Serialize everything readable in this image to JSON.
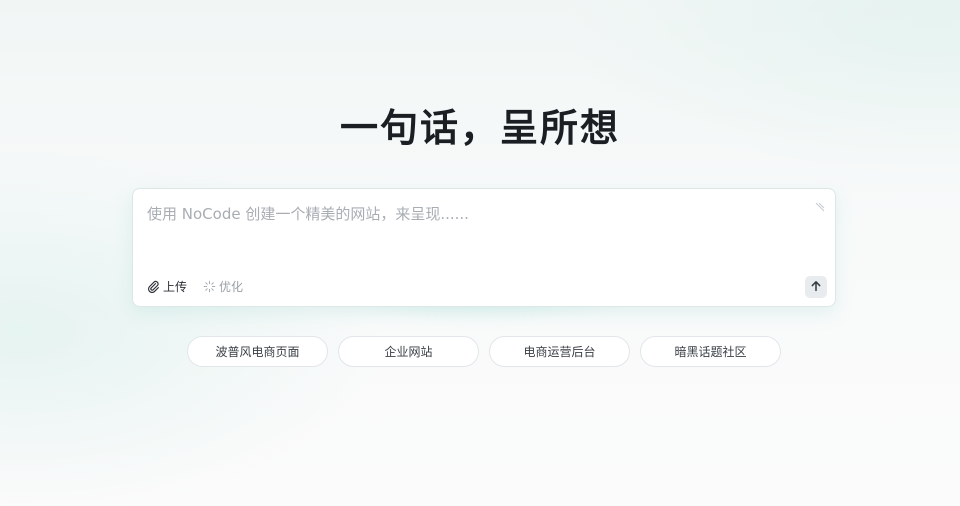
{
  "hero": {
    "title": "一句话，呈所想"
  },
  "prompt": {
    "placeholder": "使用 NoCode 创建一个精美的网站，来呈现......",
    "value": ""
  },
  "toolbar": {
    "upload_label": "上传",
    "optimize_label": "优化"
  },
  "suggestions": [
    "波普风电商页面",
    "企业网站",
    "电商运营后台",
    "暗黑话题社区"
  ],
  "icons": {
    "upload": "paperclip-icon",
    "optimize": "sparkle-icon",
    "send": "arrow-up-icon",
    "resize": "resize-handle-icon"
  },
  "colors": {
    "title": "#1b1f24",
    "placeholder": "#a8adb3",
    "accent_glow": "#96e0d2",
    "chip_border": "#e2e6ea"
  }
}
